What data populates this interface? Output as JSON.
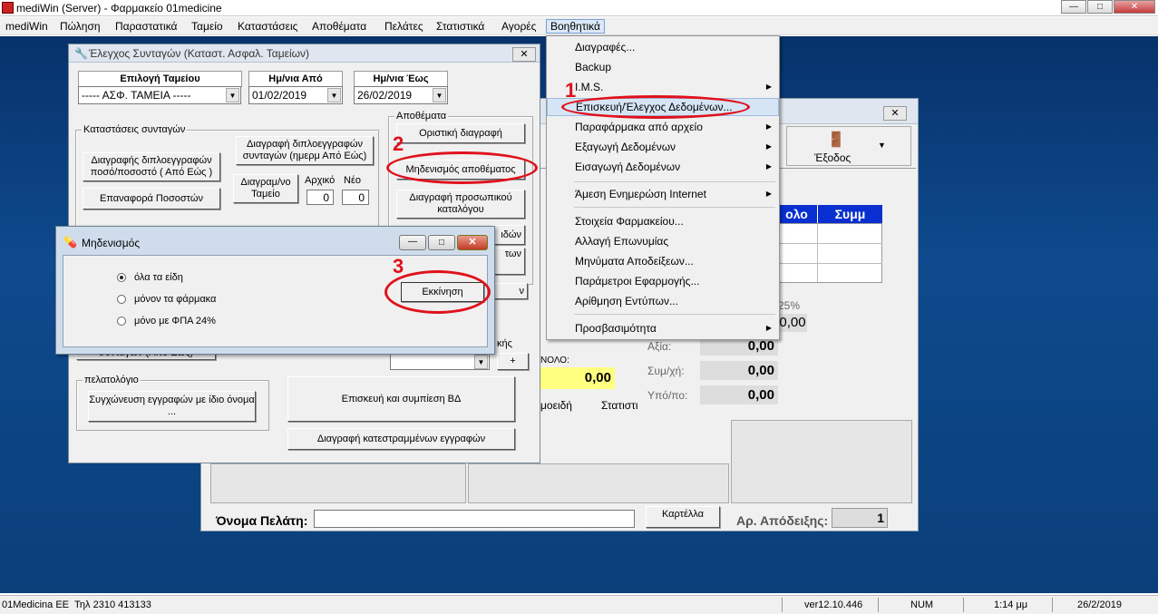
{
  "window": {
    "title": "mediWin (Server) - Φαρμακείο 01medicine"
  },
  "menubar": [
    "mediWin",
    "Πώληση",
    "Παραστατικά",
    "Ταμείο",
    "Καταστάσεις",
    "Αποθέματα",
    "Πελάτες",
    "Στατιστικά",
    "Αγορές",
    "Βοηθητικά"
  ],
  "dropdown": {
    "items": [
      {
        "label": "Διαγραφές...",
        "sub": false
      },
      {
        "label": "Backup",
        "sub": false
      },
      {
        "label": "I.M.S.",
        "sub": true
      },
      {
        "label": "Επισκευή/Έλεγχος Δεδομένων...",
        "sub": false
      },
      {
        "label": "Παραφάρμακα από αρχείο",
        "sub": true
      },
      {
        "label": "Εξαγωγή Δεδομένων",
        "sub": true
      },
      {
        "label": "Εισαγωγή Δεδομένων",
        "sub": true
      },
      {
        "label": "Άμεση Ενημερώση Internet",
        "sub": true
      },
      {
        "label": "Στοιχεία Φαρμακείου...",
        "sub": false
      },
      {
        "label": "Αλλαγή Επωνυμίας",
        "sub": false
      },
      {
        "label": "Μηνύματα Αποδείξεων...",
        "sub": false
      },
      {
        "label": "Παράμετροι Εφαρμογής...",
        "sub": false
      },
      {
        "label": "Αρίθμηση Εντύπων...",
        "sub": false
      },
      {
        "label": "Προσβασιμότητα",
        "sub": true
      }
    ]
  },
  "annotations": {
    "n1": "1",
    "n2": "2",
    "n3": "3"
  },
  "control_window": {
    "title": "Έλεγχος Συνταγών (Καταστ. Ασφαλ. Ταμείων)",
    "fund_label": "Επιλογή Ταμείου",
    "fund_value": "----- ΑΣΦ. ΤΑΜΕΙΑ -----",
    "date_from_label": "Ημ/νια Από",
    "date_from": "01/02/2019",
    "date_to_label": "Ημ/νια Έως",
    "date_to": "26/02/2019",
    "group_prescriptions": "Καταστάσεις συνταγών",
    "btn_dup_delete": "Διαγραφής διπλοεγγραφών ποσό/ποσοστό ( Από Εώς )",
    "btn_dup_delete_date": "Διαγραφή διπλοεγγραφών συνταγών (ημερμ Από Εώς)",
    "btn_restore_pct": "Επαναφορά Ποσοστών",
    "btn_delete_fund": "Διαγραμ/νο Ταμείο",
    "lbl_original": "Αρχικό",
    "lbl_new": "Νέο",
    "original_value": "0",
    "new_value": "0",
    "group_stock": "Αποθέματα",
    "btn_final_delete": "Οριστική διαγραφή",
    "btn_zero_stock": "Μηδενισμός αποθέματος",
    "btn_delete_personal": "Διαγραφή προσωπικού καταλόγου",
    "btn_partial_1": "ιδών",
    "btn_partial_2": "των",
    "btn_partial_3": "ν",
    "lbl_partial_k": "κής",
    "btn_prescriptions_dates": "συνταγών (Από Εώς)",
    "btn_plus": "+",
    "group_customers": "πελατολόγιο",
    "btn_merge": "Συγχώνευση εγγραφών με ίδιο όνομα ...",
    "btn_repair_db": "Επισκευή και συμπίεση ΒΔ",
    "btn_delete_corrupted": "Διαγραφή κατεστραμμένων εγγραφών"
  },
  "zero_dialog": {
    "title": "Μηδενισμός",
    "options": [
      "όλα τα είδη",
      "μόνον τα φάρμακα",
      "μόνο με ΦΠΑ 24%"
    ],
    "selected": 0,
    "start_button": "Εκκίνηση"
  },
  "bg_window": {
    "exit_label": "Έξοδος",
    "col_total": "ολο",
    "col_sum": "Συμμ",
    "pct": "25%",
    "val_top": "0,00",
    "axia_label": "Αξία:",
    "axia_value": "0,00",
    "symxi_label": "Συμ/χή:",
    "symxi_value": "0,00",
    "ypopo_label": "Υπό/πο:",
    "ypopo_value": "0,00",
    "total_label": "ΝΟΛΟ:",
    "total_value": "0,00",
    "tab_a": "μοειδή",
    "tab_b": "Στατιστι",
    "customer_label": "Όνομα Πελάτη:",
    "card_label": "Καρτέλλα",
    "receipt_label": "Αρ. Απόδειξης:",
    "receipt_value": "1"
  },
  "statusbar": {
    "company": "01Medicina EE",
    "phone": "Τηλ 2310 413133",
    "version": "ver12.10.446",
    "num": "NUM",
    "time": "1:14 μμ",
    "date": "26/2/2019"
  },
  "colors": {
    "accent_red": "#e0111b",
    "header_blue": "#0a2fd0",
    "highlight_yellow": "#ffff80",
    "desktop": "#0b3f7a"
  }
}
